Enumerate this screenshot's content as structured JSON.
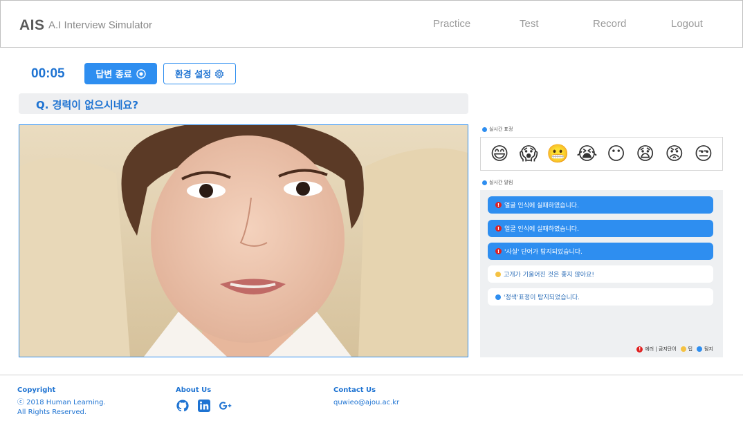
{
  "header": {
    "logo": "AIS",
    "subtitle": "A.I Interview Simulator",
    "nav": [
      "Practice",
      "Test",
      "Record",
      "Logout"
    ]
  },
  "controls": {
    "timer": "00:05",
    "end_button": "답변 종료",
    "settings_button": "환경 설정"
  },
  "question": "Q. 경력이 없으시네요?",
  "expressions": {
    "label": "실시간 표정",
    "icons": [
      "grinning-face",
      "screaming-face",
      "grimacing-face",
      "crying-face",
      "no-mouth-face",
      "anxious-face",
      "angry-face",
      "unamused-face"
    ]
  },
  "alerts": {
    "label": "실시간 알림",
    "items": [
      {
        "type": "error",
        "text": "얼굴 인식에 실패하였습니다."
      },
      {
        "type": "error",
        "text": "얼굴 인식에 실패하였습니다."
      },
      {
        "type": "error",
        "text": "'사실' 단어가 탐지되었습니다."
      },
      {
        "type": "tip",
        "text": "고개가 기울어진 것은 좋지 않아요!"
      },
      {
        "type": "detect",
        "text": "'정색'표정이 탐지되었습니다."
      }
    ],
    "legend": {
      "error": "에러 | 금지단어",
      "tip": "팁",
      "detect": "탐지"
    }
  },
  "footer": {
    "copyright_title": "Copyright",
    "copyright_line1": "ⓒ 2018 Human Learning.",
    "copyright_line2": "All Rights Reserved.",
    "about_title": "About Us",
    "contact_title": "Contact Us",
    "email": "quwieo@ajou.ac.kr"
  },
  "colors": {
    "accent": "#2e8ef0",
    "accent_text": "#1e73d2",
    "error": "#e02020",
    "tip": "#f5c242"
  }
}
